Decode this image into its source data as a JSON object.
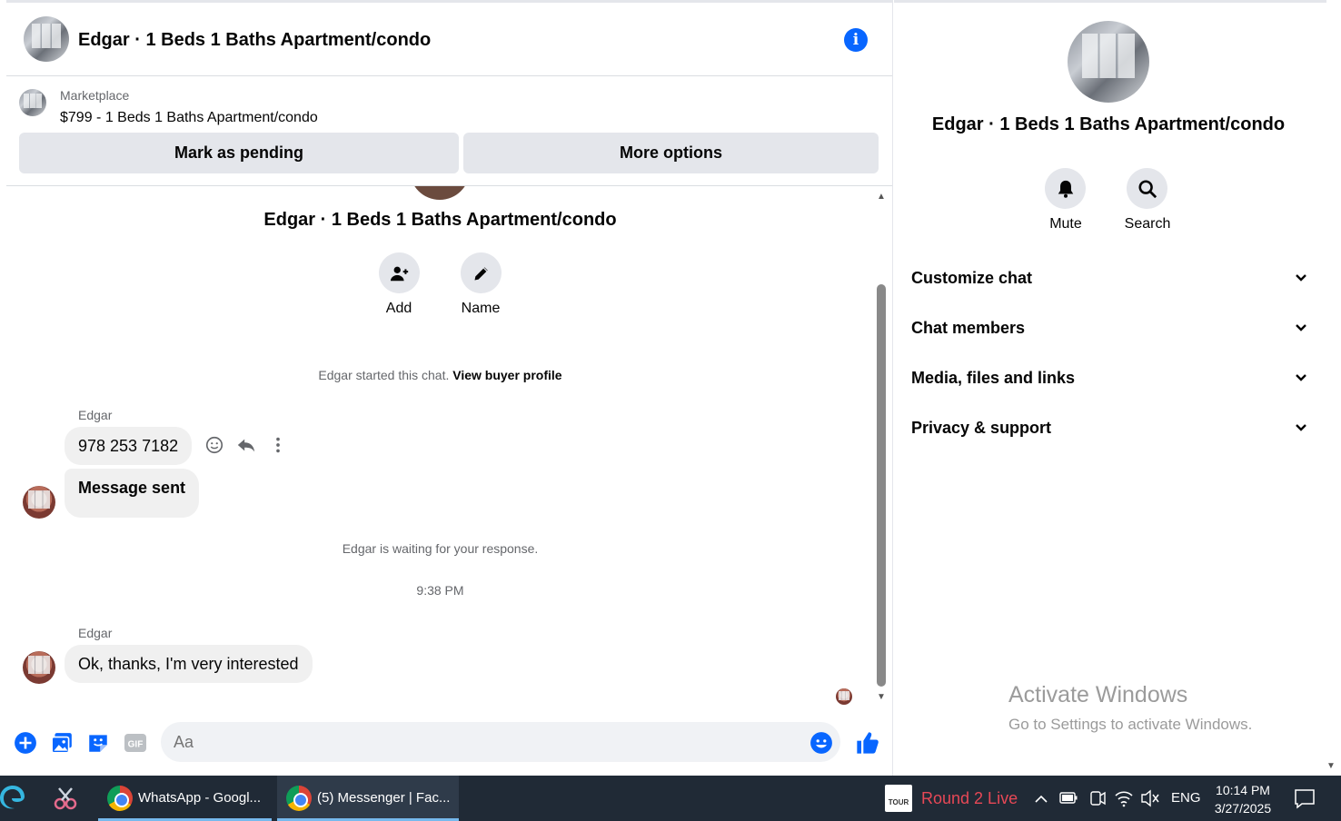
{
  "header": {
    "title": "Edgar · 1 Beds 1 Baths Apartment/condo"
  },
  "listing": {
    "label": "Marketplace",
    "price_title": "$799 - 1 Beds 1 Baths Apartment/condo",
    "pending_button": "Mark as pending",
    "more_button": "More options"
  },
  "conversation": {
    "title": "Edgar · 1 Beds 1 Baths Apartment/condo",
    "add_label": "Add",
    "name_label": "Name",
    "started_text": "Edgar started this chat.",
    "view_profile": "View buyer profile",
    "messages": [
      {
        "sender": "Edgar",
        "text": "978 253 7182"
      },
      {
        "text": "Message sent"
      },
      {
        "sender": "Edgar",
        "text": "Ok, thanks, I'm very interested"
      }
    ],
    "waiting_text": "Edgar is waiting for your response.",
    "timestamp": "9:38 PM"
  },
  "composer": {
    "placeholder": "Aa",
    "gif_label": "GIF"
  },
  "panel": {
    "title": "Edgar · 1 Beds 1 Baths Apartment/condo",
    "mute_label": "Mute",
    "search_label": "Search",
    "sections": [
      "Customize chat",
      "Chat members",
      "Media, files and links",
      "Privacy & support"
    ]
  },
  "watermark": {
    "line1": "Activate Windows",
    "line2": "Go to Settings to activate Windows."
  },
  "taskbar": {
    "apps": [
      "WhatsApp - Googl...",
      "(5) Messenger | Fac..."
    ],
    "widget_text": "Round 2 Live",
    "widget_icon_text": "TOUR",
    "language": "ENG",
    "time": "10:14 PM",
    "date": "3/27/2025"
  },
  "colors": {
    "accent": "#0866ff",
    "bubble": "#f0f0f0",
    "taskbar": "#202a36",
    "live": "#e74856"
  }
}
